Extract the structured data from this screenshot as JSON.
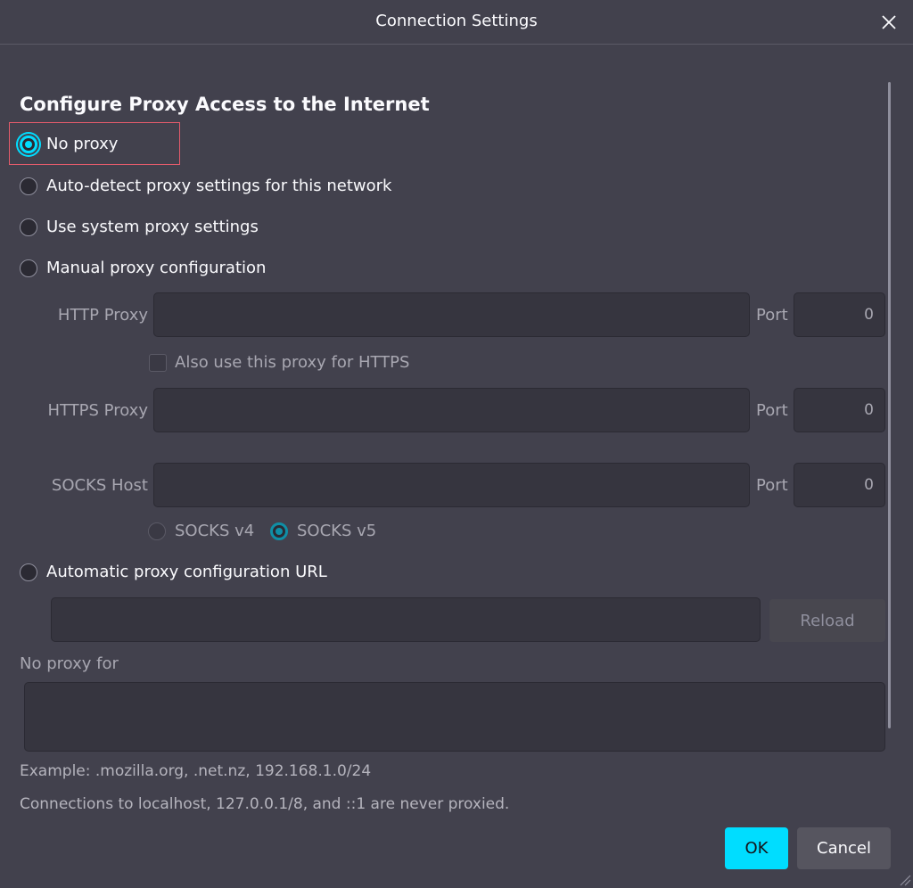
{
  "window": {
    "title": "Connection Settings"
  },
  "heading": "Configure Proxy Access to the Internet",
  "proxy_options": [
    {
      "label": "No proxy",
      "selected": true
    },
    {
      "label": "Auto-detect proxy settings for this network",
      "selected": false
    },
    {
      "label": "Use system proxy settings",
      "selected": false
    },
    {
      "label": "Manual proxy configuration",
      "selected": false
    }
  ],
  "manual": {
    "http_label": "HTTP Proxy",
    "http_value": "",
    "port_label": "Port",
    "http_port": "0",
    "also_https_label": "Also use this proxy for HTTPS",
    "https_label": "HTTPS Proxy",
    "https_value": "",
    "https_port": "0",
    "socks_label": "SOCKS Host",
    "socks_value": "",
    "socks_port": "0",
    "socks_v4_label": "SOCKS v4",
    "socks_v5_label": "SOCKS v5",
    "socks_version": "v5"
  },
  "auto_config": {
    "label": "Automatic proxy configuration URL",
    "url_value": "",
    "reload_label": "Reload"
  },
  "no_proxy": {
    "label": "No proxy for",
    "value": "",
    "example": "Example: .mozilla.org, .net.nz, 192.168.1.0/24",
    "note": "Connections to localhost, 127.0.0.1/8, and ::1 are never proxied."
  },
  "buttons": {
    "ok": "OK",
    "cancel": "Cancel"
  },
  "colors": {
    "accent": "#00ddff",
    "background": "#42414d",
    "highlight": "#e35b6b"
  }
}
